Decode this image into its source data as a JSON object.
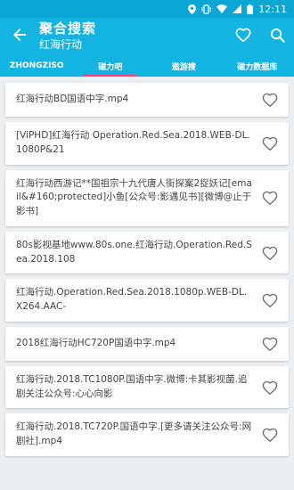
{
  "status": {
    "time": "12:11"
  },
  "app_bar": {
    "title": "聚合搜索",
    "subtitle": "红海行动"
  },
  "tabs": [
    {
      "label": "ZHONGZISO"
    },
    {
      "label": "磁力吧"
    },
    {
      "label": "遨游搜"
    },
    {
      "label": "磁力数据库"
    }
  ],
  "active_tab": "磁力吧",
  "results": [
    {
      "title": "红海行动BD国语中字.mp4"
    },
    {
      "title": "[ViPHD]红海行动 Operation.Red.Sea.2018.WEB-DL.1080P&21"
    },
    {
      "title": "红海行动西游记**国祖宗十九代唐人街探案2捉妖记[email&#160;protected]小鱼[公众号:影遇见书][微博@止于影书]"
    },
    {
      "title": "80s影视基地www.80s.one.红海行动.Operation.Red.Sea.2018.108"
    },
    {
      "title": "红海行动.Operation.Red.Sea.2018.1080p.WEB-DL.X264.AAC-"
    },
    {
      "title": "2018红海行动HC720P国语中字.mp4"
    },
    {
      "title": "红海行动.2018.TC1080P.国语中字.微博:卡其影视菌.追剧关注公众号:心心向影"
    },
    {
      "title": "红海行动.2018.TC720P.国语中字.[更多请关注公众号:网剧社].mp4"
    }
  ],
  "colors": {
    "primary": "#14b4e2",
    "status_bar": "#0aa6d4",
    "indicator": "#ff4081"
  }
}
